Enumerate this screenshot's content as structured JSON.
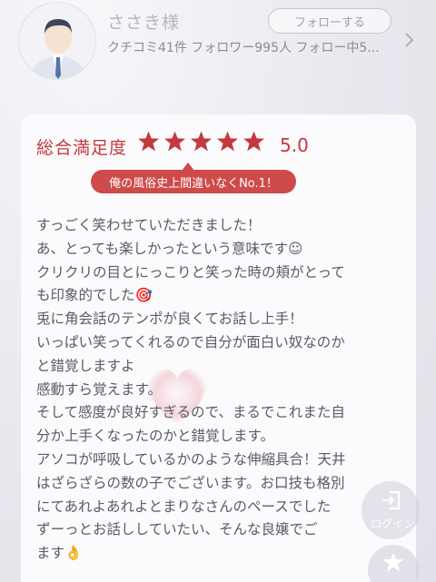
{
  "profile": {
    "username": "ささき様",
    "follow_label": "フォローする",
    "stats": "クチコミ41件 フォロワー995人 フォロー中5..."
  },
  "review": {
    "rating_label": "総合満足度",
    "star_count": 5,
    "score": "5.0",
    "catch_copy": "俺の風俗史上間違いなくNo.1！",
    "lines": [
      "すっごく笑わせていただきました！",
      "あ、とっても楽しかったという意味です☺",
      "クリクリの目とにっこりと笑った時の頬がとって",
      "も印象的でした🎯",
      "兎に角会話のテンポが良くてお話し上手！",
      "いっぱい笑ってくれるので自分が面白い奴なのか",
      "と錯覚しますよ",
      "感動すら覚えます。",
      "そして感度が良好すぎるので、まるでこれまた自",
      "分か上手くなったのかと錯覚します。",
      "アソコが呼吸しているかのような伸縮具合！天井",
      "はざらざらの数の子でございます。お口技も格別",
      "にてあれよあれよとまりなさんのペースでした",
      "ずーっとお話ししていたい、そんな良嬢でご",
      "ます👌"
    ]
  },
  "fab": {
    "login_label": "ログイン"
  },
  "colors": {
    "accent": "#c4383f",
    "badge": "#cf4a4a",
    "text": "#5d5a62"
  },
  "icons": [
    "user-avatar",
    "chevron-right-icon",
    "star-icon",
    "login-icon"
  ]
}
